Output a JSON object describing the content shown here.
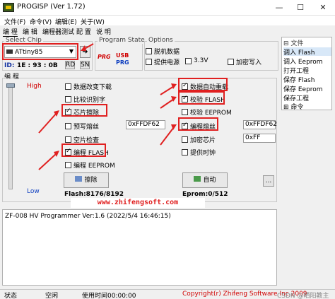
{
  "titlebar": {
    "title": "PROGISP (Ver 1.72)",
    "min": "—",
    "max": "☐",
    "close": "✕"
  },
  "menu": [
    "文件(F)",
    "命令(V)",
    "编辑(E)",
    "关于(W)"
  ],
  "tabs": [
    "编 程",
    "编 辑",
    "编程器测试",
    "配 置",
    "说 明"
  ],
  "select_chip": {
    "label": "Select Chip",
    "value": "ATtiny85",
    "id_label": "ID:",
    "id_value": "1E : 93 : 0B",
    "rd_label": "RD",
    "sn_label": "SN"
  },
  "program_state": {
    "label": "Program State",
    "prg": "PRG",
    "usb": "USB",
    "prg2": "PRG"
  },
  "options": {
    "label": "Options",
    "items": [
      {
        "label": "脱机数据",
        "checked": false
      },
      {
        "label": "提供电源",
        "checked": false
      },
      {
        "label": "3.3V",
        "checked": false
      },
      {
        "label": "加密写入",
        "checked": false
      }
    ]
  },
  "prog_panel": {
    "label": "编 程",
    "high": "High",
    "low": "Low",
    "left_options": [
      {
        "label": "数据改变下载",
        "checked": false
      },
      {
        "label": "比较识别字",
        "checked": false
      },
      {
        "label": "芯片擦除",
        "checked": true
      },
      {
        "label": "预写熔丝",
        "checked": false
      },
      {
        "label": "空片检查",
        "checked": false
      },
      {
        "label": "编程 FLASH",
        "checked": true
      },
      {
        "label": "编程 EEPROM",
        "checked": false
      }
    ],
    "right_options": [
      {
        "label": "数据自动重载",
        "checked": true
      },
      {
        "label": "校验 FLASH",
        "checked": true
      },
      {
        "label": "校验 EEPROM",
        "checked": false
      },
      {
        "label": "编程熔丝",
        "checked": true
      },
      {
        "label": "加密芯片",
        "checked": false
      },
      {
        "label": "提供时钟",
        "checked": false
      }
    ],
    "fuse_field_1": "0xFFDF62",
    "fuse_field_2": "0xFFDF62",
    "lock_field": "0xFF",
    "erase_button": "擦除",
    "auto_button": "自动",
    "more_button": "...",
    "flash_info": "Flash:8176/8192",
    "eprom_info": "Eprom:0/512"
  },
  "sidebar": {
    "header": "文件",
    "items": [
      "调入 Flash",
      "调入 Eeprom",
      "打开工程",
      "保存 Flash",
      "保存 Eeprom",
      "保存工程"
    ],
    "footer": "命令"
  },
  "watermark": "www.zhifengsoft.com",
  "log": {
    "line1": "ZF-008 HV Programmer Ver:1.6 (2022/5/4 16:46:15)"
  },
  "status": {
    "state_label": "状态",
    "state_value": "空闲",
    "time_label": "使用时间00:00:00",
    "copyright": "Copyright(r) Zhifeng Software Inc 2009",
    "csdn": "CSDN @晒阳教主"
  },
  "colors": {
    "accent_red": "#e02020",
    "watermark_bg": "#ffffff",
    "sidebar_selected": "#d8e8f8"
  }
}
